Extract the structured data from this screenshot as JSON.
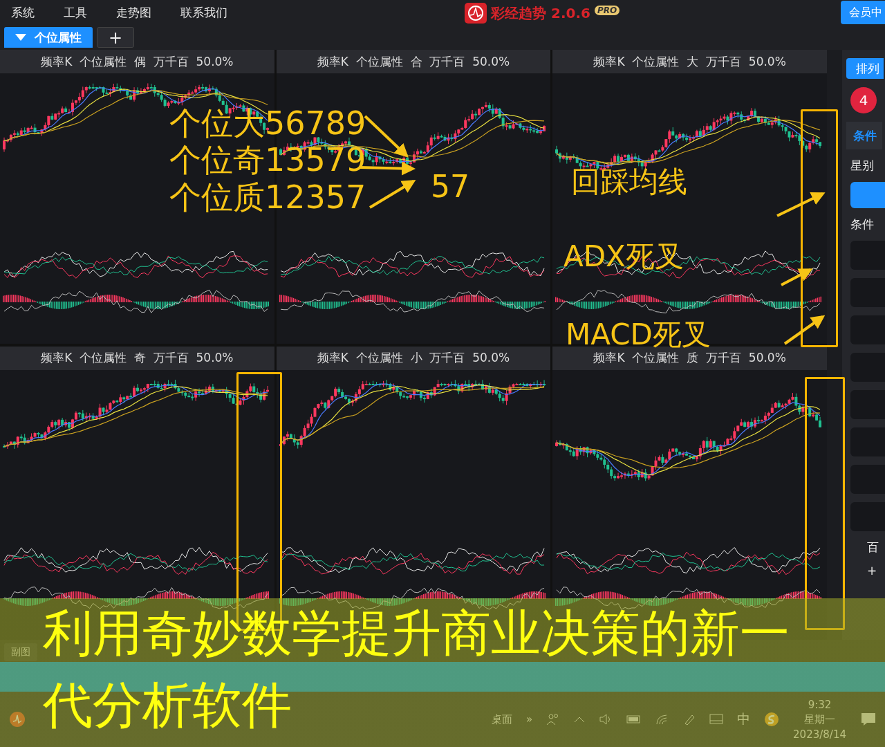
{
  "menu": [
    {
      "label": "系统"
    },
    {
      "label": "工具"
    },
    {
      "label": "走势图"
    },
    {
      "label": "联系我们"
    }
  ],
  "brand": {
    "name": "彩经趋势 2.0.6",
    "badge": "PRO"
  },
  "member_button": "会员中",
  "tabs": [
    {
      "label": "个位属性",
      "selected": true
    }
  ],
  "add_tab": "+",
  "panels": [
    {
      "title": "频率K  个位属性  偶  万千百  50.0%"
    },
    {
      "title": "频率K  个位属性  合  万千百  50.0%"
    },
    {
      "title": "频率K  个位属性  大  万千百  50.0%"
    },
    {
      "title": "频率K  个位属性  奇  万千百  50.0%"
    },
    {
      "title": "频率K  个位属性  小  万千百  50.0%"
    },
    {
      "title": "频率K  个位属性  质  万千百  50.0%"
    }
  ],
  "sidebar": {
    "sort_button": "排列",
    "badge": "4",
    "tab": "条件",
    "star_label": "星别",
    "section_label": "条件",
    "items": [
      {
        "kind": "blank"
      },
      {
        "kind": "blank"
      },
      {
        "kind": "blank"
      },
      {
        "kind": "blank"
      },
      {
        "kind": "blank"
      },
      {
        "kind": "blank"
      },
      {
        "kind": "blank"
      },
      {
        "kind": "blank"
      }
    ],
    "footer": [
      "百",
      "+"
    ]
  },
  "bottom_tabs": [
    {
      "kind": "labeled",
      "label": "副图",
      "selected": false
    }
  ],
  "taskbar": {
    "desktop": "桌面",
    "chevron": "»",
    "ime": "中",
    "time": "9:32",
    "weekday": "星期一",
    "date": "2023/8/14"
  },
  "annotations": [
    {
      "text": "个位大56789"
    },
    {
      "text": "个位奇13579"
    },
    {
      "text": "个位质12357"
    },
    {
      "text": "57"
    },
    {
      "text": "回踩均线"
    },
    {
      "text": "ADX死叉"
    },
    {
      "text": "MACD死叉"
    }
  ],
  "caption_lines": [
    "利用奇妙数学提升商业决策的新一",
    "代分析软件"
  ]
}
